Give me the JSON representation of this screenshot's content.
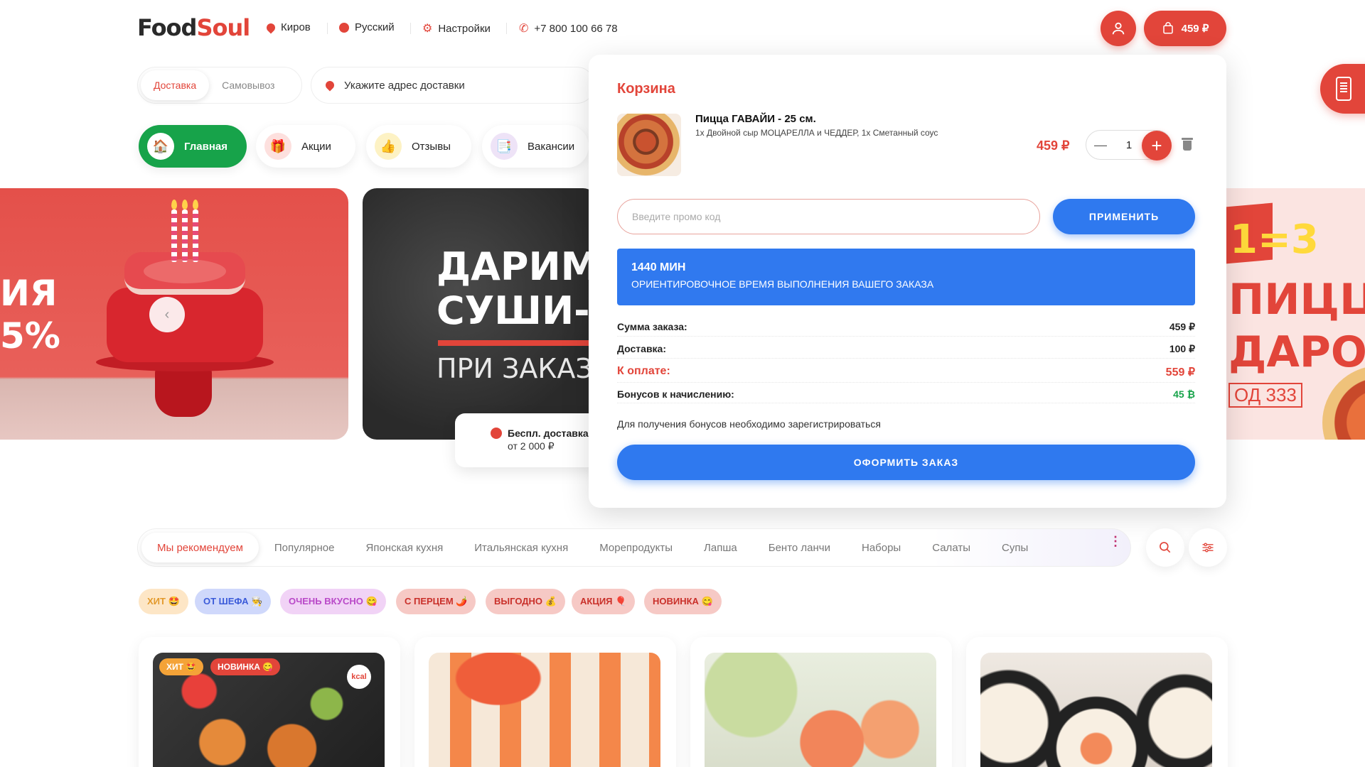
{
  "header": {
    "logo_food": "Food",
    "logo_soul": "Soul",
    "city": "Киров",
    "language": "Русский",
    "settings": "Настройки",
    "phone": "+7 800 100 66 78",
    "cart_total": "459 ₽"
  },
  "delivery": {
    "options": [
      "Доставка",
      "Самовывоз"
    ],
    "active": "Доставка",
    "address_placeholder": "Укажите адрес доставки"
  },
  "nav": [
    {
      "label": "Главная",
      "icon": "home-icon"
    },
    {
      "label": "Акции",
      "icon": "gift-icon"
    },
    {
      "label": "Отзывы",
      "icon": "thumbs-up-icon"
    },
    {
      "label": "Вакансии",
      "icon": "document-icon"
    }
  ],
  "banners": {
    "left_text": "ИЯ\n5%",
    "mid_line1": "ДАРИМ",
    "mid_line2": "СУШИ-С",
    "mid_line3": "ПРИ ЗАКАЗЕ",
    "free_delivery_title": "Беспл. доставка",
    "free_delivery_sub": "от 2 000 ₽",
    "right_ribbon": "1=3",
    "right_line1": "ПИЦЦА",
    "right_line2": "ДАРОК",
    "right_code": "ОД 333"
  },
  "cart": {
    "title": "Корзина",
    "item": {
      "name": "Пицца ГАВАЙИ - 25 см.",
      "description": "1x Двойной сыр МОЦАРЕЛЛА и ЧЕДДЕР, 1x Сметанный соус",
      "price": "459 ₽",
      "quantity": "1"
    },
    "promo_placeholder": "Введите промо код",
    "apply_label": "ПРИМЕНИТЬ",
    "eta_minutes": "1440 МИН",
    "eta_text": "ОРИЕНТИРОВОЧНОЕ ВРЕМЯ ВЫПОЛНЕНИЯ ВАШЕГО ЗАКАЗА",
    "summary": [
      {
        "label": "Сумма заказа:",
        "value": "459 ₽"
      },
      {
        "label": "Доставка:",
        "value": "100 ₽"
      },
      {
        "label": "К оплате:",
        "value": "559 ₽"
      },
      {
        "label": "Бонусов к начислению:",
        "value": "45 ₿"
      }
    ],
    "bonus_note": "Для получения бонусов необходимо зарегистрироваться",
    "checkout_label": "ОФОРМИТЬ ЗАКАЗ"
  },
  "categories": [
    "Мы рекомендуем",
    "Популярное",
    "Японская кухня",
    "Итальянская кухня",
    "Морепродукты",
    "Лапша",
    "Бенто ланчи",
    "Наборы",
    "Салаты",
    "Супы"
  ],
  "tags": [
    {
      "label": "ХИТ 🤩",
      "bg": "#fde6c6",
      "fg": "#e39a2c"
    },
    {
      "label": "ОТ ШЕФА 👨‍🍳",
      "bg": "#cfd8fb",
      "fg": "#3b5bd9"
    },
    {
      "label": "ОЧЕНЬ ВКУСНО 😋",
      "bg": "#f1d3f6",
      "fg": "#b948c8"
    },
    {
      "label": "С ПЕРЦЕМ 🌶️",
      "bg": "#f6c9c5",
      "fg": "#c9302a"
    },
    {
      "label": "ВЫГОДНО 💰",
      "bg": "#f6c9c5",
      "fg": "#c9302a"
    },
    {
      "label": "АКЦИЯ 🎈",
      "bg": "#f6c9c5",
      "fg": "#c9302a"
    },
    {
      "label": "НОВИНКА 😋",
      "bg": "#f6c9c5",
      "fg": "#c9302a"
    }
  ],
  "card_badges": {
    "hit": "ХИТ 🤩",
    "new": "НОВИНКА 😋",
    "kcal": "kcal"
  },
  "colors": {
    "accent": "#e2453a",
    "blue": "#2f79ef",
    "green": "#17a34a"
  }
}
